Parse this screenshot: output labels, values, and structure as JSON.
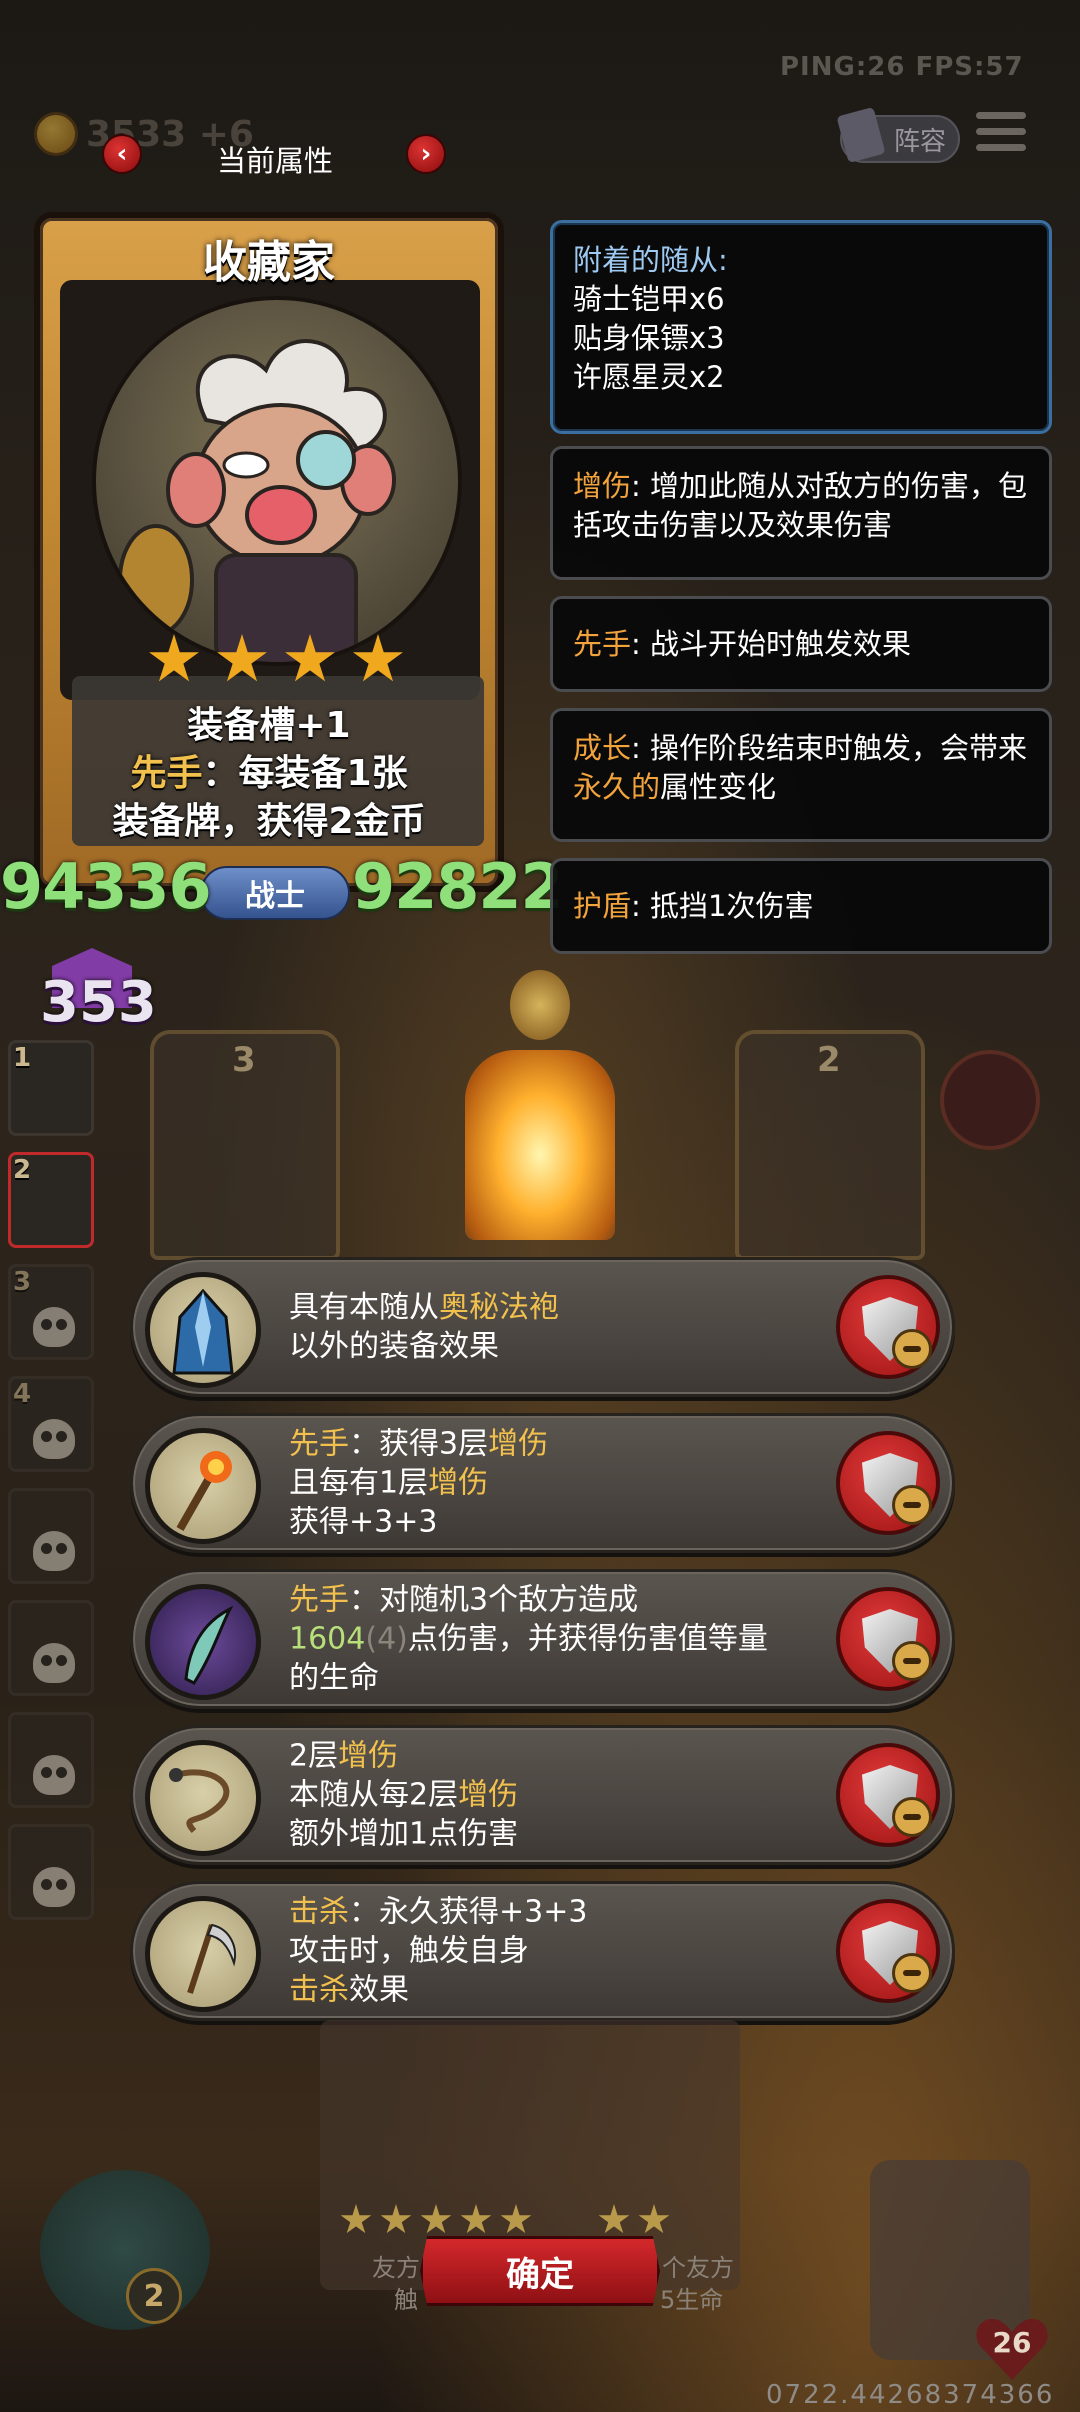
{
  "hud": {
    "ping_fps": "PING:26   FPS:57",
    "gold": "3533 +6",
    "lineup_label": "阵容"
  },
  "header": {
    "title": "当前属性",
    "prev_arrow": "‹",
    "next_arrow": "›"
  },
  "hero": {
    "name": "收藏家",
    "stars": 4,
    "ability_line1": "装备槽+1",
    "ability_kw": "先手",
    "ability_line2_rest": "：每装备1张",
    "ability_line3": "装备牌，获得2金币",
    "attack": "94336",
    "class": "战士",
    "health": "92822",
    "purple_value": "353"
  },
  "tooltips": {
    "attached_title": "附着的随从:",
    "attached": [
      "骑士铠甲x6",
      "贴身保镖x3",
      "许愿星灵x2"
    ],
    "kw_damage": "增伤",
    "kw_damage_desc": ": 增加此随从对敌方的伤害，包括攻击伤害以及效果伤害",
    "kw_first": "先手",
    "kw_first_desc": ": 战斗开始时触发效果",
    "kw_growth": "成长",
    "kw_growth_desc": ": 操作阶段结束时触发，会带来",
    "kw_growth_kw2": "永久的",
    "kw_growth_desc2": "属性变化",
    "kw_shield": "护盾",
    "kw_shield_desc": ": 抵挡1次伤害"
  },
  "party": {
    "slots": [
      {
        "num": "1",
        "state": "portrait"
      },
      {
        "num": "2",
        "state": "portrait-active"
      },
      {
        "num": "3",
        "state": "skull"
      },
      {
        "num": "4",
        "state": "skull"
      },
      {
        "num": "",
        "state": "skull"
      },
      {
        "num": "",
        "state": "skull"
      },
      {
        "num": "",
        "state": "skull"
      },
      {
        "num": "",
        "state": "skull"
      }
    ]
  },
  "board": {
    "left_card_num": "3",
    "right_card_num": "2"
  },
  "equipment": [
    {
      "icon": "arcane-robe-icon",
      "l1a": "具有本随从",
      "l1kw": "奥秘法袍",
      "l1b": "",
      "l2": "以外的装备效果"
    },
    {
      "icon": "fire-staff-icon",
      "l1kw0": "先手",
      "l1a": "：获得3层",
      "l1kw": "增伤",
      "l2a": "且每有1层",
      "l2kw": "增伤",
      "l3": "获得+3+3"
    },
    {
      "icon": "void-blade-icon",
      "l1kw0": "先手",
      "l1a": "：对随机3个敌方造成",
      "l2num": "1604",
      "l2dim": "(4)",
      "l2a": "点伤害，并获得伤害值等量",
      "l3": "的生命"
    },
    {
      "icon": "whip-icon",
      "l1a": "2层",
      "l1kw": "增伤",
      "l2a": "本随从每2层",
      "l2kw": "增伤",
      "l3": "额外增加1点伤害"
    },
    {
      "icon": "scythe-icon",
      "l1kw0": "击杀",
      "l1a": "：永久获得+3+3",
      "l2": "攻击时，触发自身",
      "l3kw": "击杀",
      "l3a": "效果"
    }
  ],
  "bottom": {
    "hint_left_1": "友方",
    "hint_left_2": "触",
    "hint_right_1": "个友方",
    "hint_right_2": "5生命",
    "confirm": "确定",
    "left_badge": "2",
    "right_badge": "26",
    "footer_id": "0722.44268374366"
  },
  "colors": {
    "keyword": "#f2c14d",
    "keyword_tooltip": "#f2a33c",
    "stat_green": "#8fe07a",
    "confirm_red": "#c21f23"
  }
}
